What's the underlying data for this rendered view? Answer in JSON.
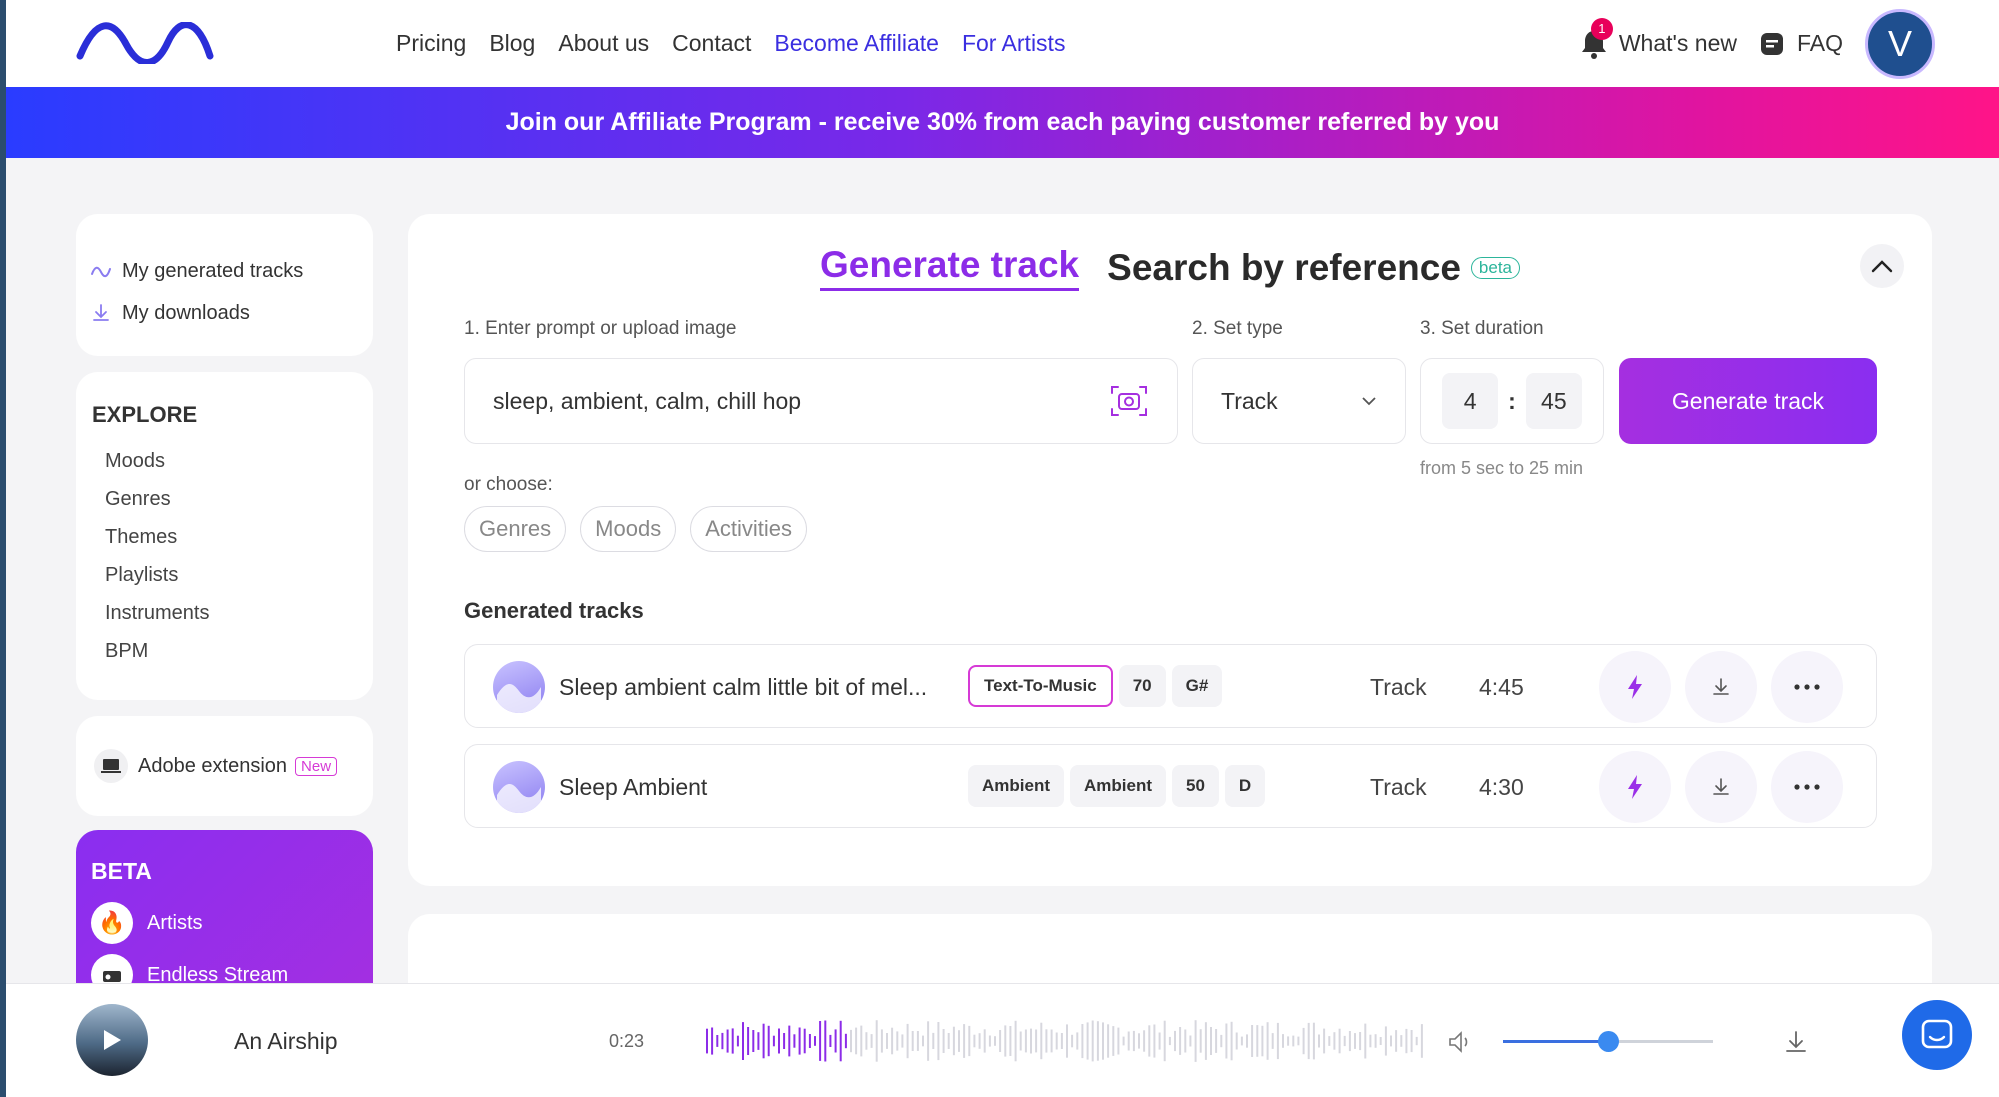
{
  "nav": {
    "items": [
      {
        "label": "Pricing"
      },
      {
        "label": "Blog"
      },
      {
        "label": "About us"
      },
      {
        "label": "Contact"
      },
      {
        "label": "Become Affiliate"
      },
      {
        "label": "For Artists"
      }
    ],
    "whats_new": "What's new",
    "notification_count": "1",
    "faq": "FAQ",
    "avatar_letter": "V"
  },
  "banner": {
    "text": "Join our Affiliate Program - receive 30% from each paying customer referred by you"
  },
  "sidebar": {
    "my_generated": "My generated tracks",
    "my_downloads": "My downloads",
    "explore_title": "EXPLORE",
    "explore_items": [
      "Moods",
      "Genres",
      "Themes",
      "Playlists",
      "Instruments",
      "BPM"
    ],
    "adobe_label": "Adobe extension",
    "adobe_badge": "New",
    "beta_title": "BETA",
    "beta_items": [
      "Artists",
      "Endless Stream"
    ]
  },
  "generator": {
    "tab_generate": "Generate track",
    "tab_search": "Search by reference",
    "tab_search_badge": "beta",
    "step1_label": "1. Enter prompt or upload image",
    "step2_label": "2. Set type",
    "step3_label": "3. Set duration",
    "prompt_value": "sleep, ambient, calm, chill hop",
    "type_value": "Track",
    "duration_min": "4",
    "duration_sep": ":",
    "duration_sec": "45",
    "duration_hint": "from 5 sec to 25 min",
    "generate_button": "Generate track",
    "or_choose": "or choose:",
    "chips": [
      "Genres",
      "Moods",
      "Activities"
    ]
  },
  "generated": {
    "title": "Generated tracks",
    "tracks": [
      {
        "name": "Sleep ambient calm little bit of mel...",
        "tags": [
          "Text-To-Music",
          "70",
          "G#"
        ],
        "type": "Track",
        "duration": "4:45"
      },
      {
        "name": "Sleep Ambient",
        "tags": [
          "Ambient",
          "Ambient",
          "50",
          "D"
        ],
        "type": "Track",
        "duration": "4:30"
      }
    ]
  },
  "player": {
    "title": "An Airship",
    "elapsed": "0:23",
    "progress": 0.2,
    "volume": 0.5
  },
  "colors": {
    "accent_purple": "#8c2ce8",
    "link_blue": "#3a2ee0",
    "tag_outline": "#d63ad6",
    "beta_teal": "#2cb59b"
  }
}
